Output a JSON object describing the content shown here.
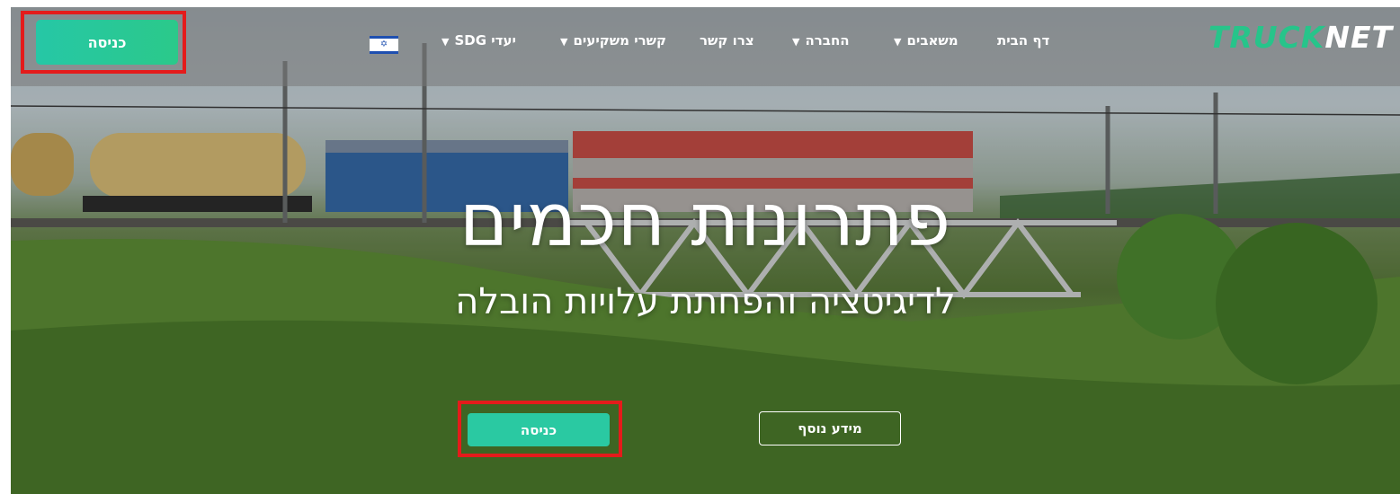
{
  "brand": {
    "logo_part1": "TRUCK",
    "logo_part2": "NET"
  },
  "nav": {
    "home": "דף הבית",
    "resources": "משאבים",
    "company": "החברה",
    "contact": "צרו קשר",
    "investors": "קשרי משקיעים",
    "sdg": "יעדי SDG"
  },
  "header": {
    "login_label": "כניסה"
  },
  "hero": {
    "headline": "פתרונות חכמים",
    "subheadline": "לדיגיטציה והפחתת עלויות הובלה",
    "cta_login": "כניסה",
    "cta_more": "מידע נוסף"
  },
  "icons": {
    "language_flag": "israel-flag-icon",
    "dropdown": "chevron-down-icon"
  },
  "colors": {
    "accent": "#2ac9a2",
    "highlight": "#e41b1b",
    "logo_green": "#27c48a"
  }
}
